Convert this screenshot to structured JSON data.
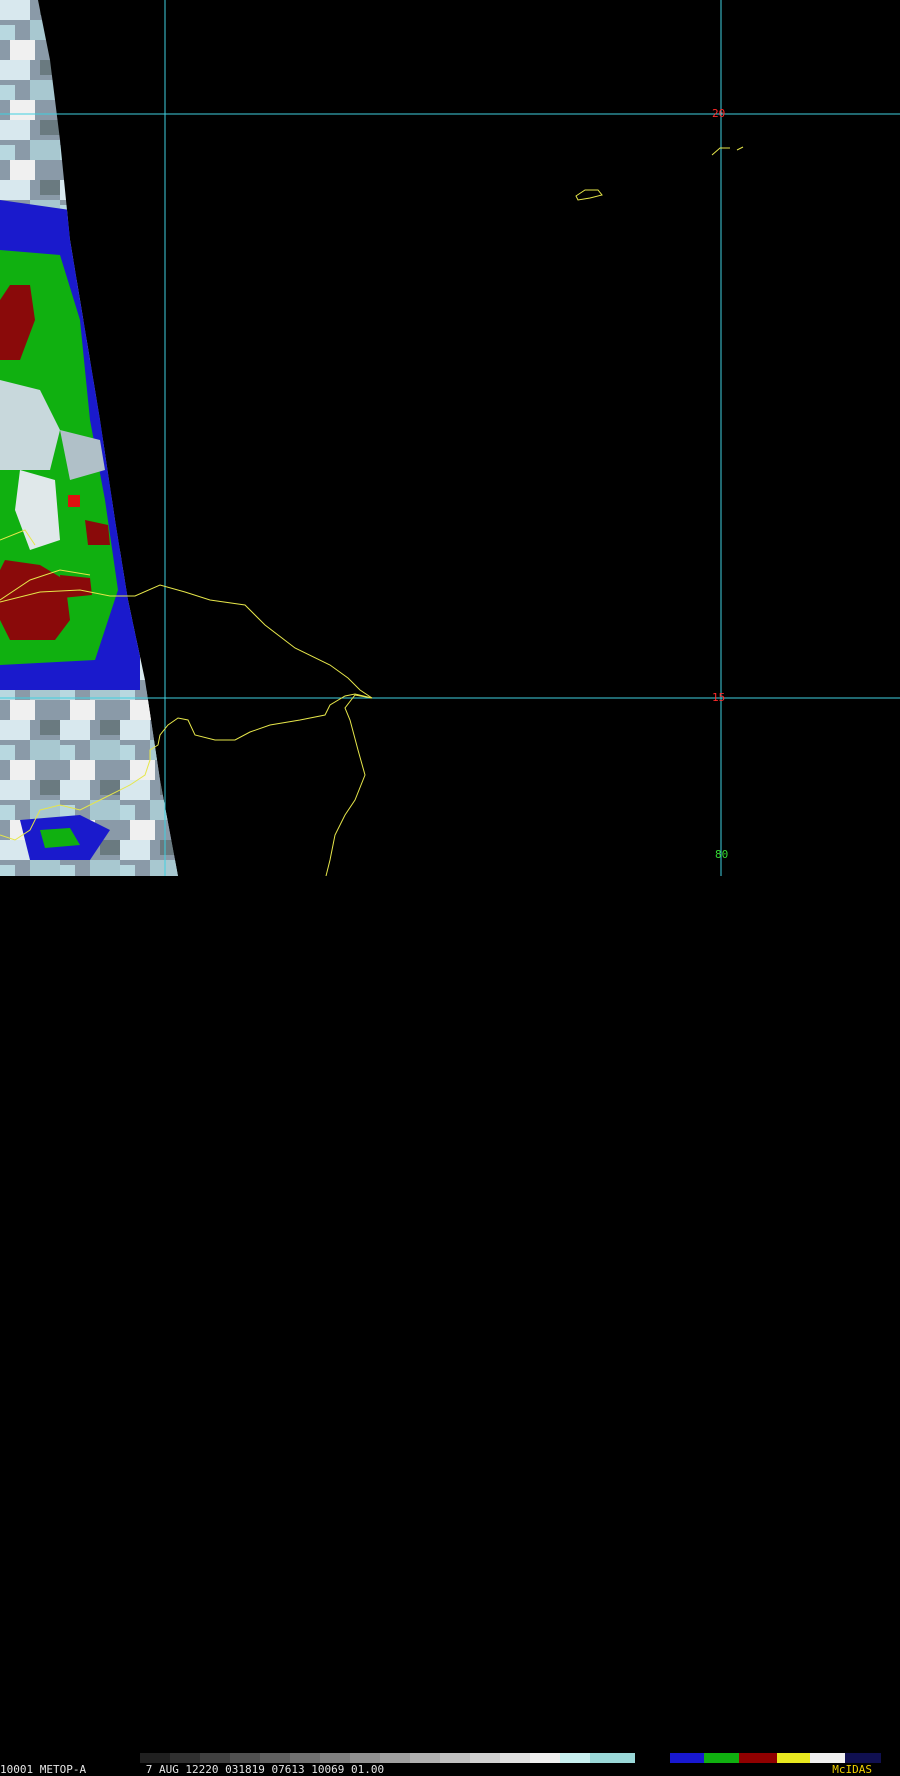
{
  "image": {
    "satellite_swath_note": "",
    "grid": {
      "lat_labels": [
        {
          "value": "20"
        },
        {
          "value": "15"
        }
      ],
      "lon_labels": [
        {
          "value": "80"
        }
      ]
    }
  },
  "footer": {
    "frame_number": "1",
    "info_text": "0001 METOP-A         7 AUG 12220 031819 07613 10069 01.00",
    "brand": "McIDAS"
  },
  "colors": {
    "grid_line": "#3fd0e0",
    "coastline": "#e6e64a",
    "background": "#000000"
  }
}
